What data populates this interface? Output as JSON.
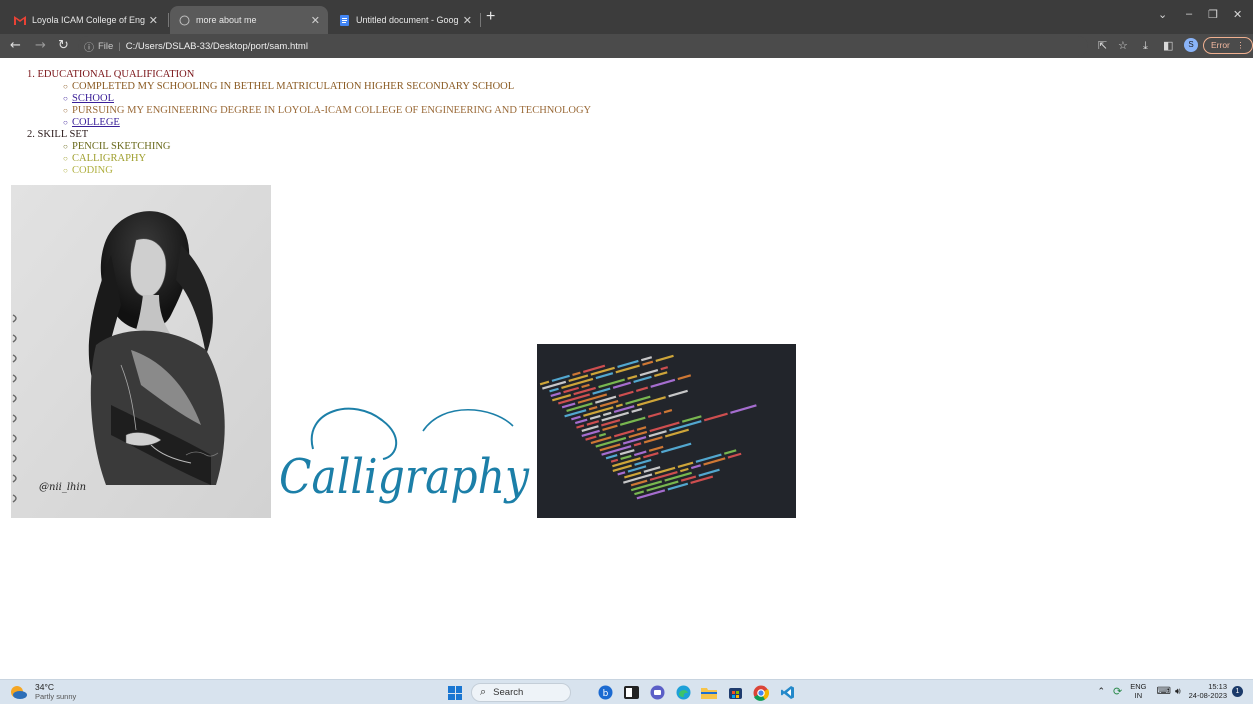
{
  "browser": {
    "tabs": [
      {
        "title": "Loyola ICAM College of Engineer",
        "favicon": "gmail-icon",
        "active": false
      },
      {
        "title": "more about me",
        "favicon": "globe-icon",
        "active": true
      },
      {
        "title": "Untitled document - Google Doc",
        "favicon": "docs-icon",
        "active": false
      }
    ],
    "address": {
      "scheme": "File",
      "url": "C:/Users/DSLAB-33/Desktop/port/sam.html"
    },
    "profile_initial": "S",
    "error_label": "Error"
  },
  "page": {
    "sections": [
      {
        "heading": "1. EDUCATIONAL QUALIFICATION",
        "items": [
          {
            "text": "COMPLETED MY SCHOOLING IN BETHEL MATRICULATION HIGHER SECONDARY SCHOOL",
            "link": false,
            "color": "#8a5a22"
          },
          {
            "text": "SCHOOL",
            "link": true,
            "color": "#3a1f98"
          },
          {
            "text": "PURSUING MY ENGINEERING DEGREE IN LOYOLA-ICAM COLLEGE OF ENGINEERING AND TECHNOLOGY",
            "link": false,
            "color": "#9a6a38"
          },
          {
            "text": "COLLEGE",
            "link": true,
            "color": "#3a1f98"
          }
        ]
      },
      {
        "heading": "2. SKILL SET",
        "items": [
          {
            "text": "PENCIL SKETCHING",
            "link": false,
            "color": "#6a6a1c"
          },
          {
            "text": "CALLIGRAPHY",
            "link": false,
            "color": "#a0a030"
          },
          {
            "text": "CODING",
            "link": false,
            "color": "#b0b040"
          }
        ]
      }
    ],
    "images": {
      "sketch_signature": "@nii_lhin",
      "calligraphy_word": "Calligraphy"
    }
  },
  "taskbar": {
    "weather": {
      "temp": "34°C",
      "condition": "Partly sunny"
    },
    "search_placeholder": "Search",
    "lang_top": "ENG",
    "lang_bottom": "IN",
    "time": "15:13",
    "date": "24-08-2023",
    "notification_count": "1"
  }
}
